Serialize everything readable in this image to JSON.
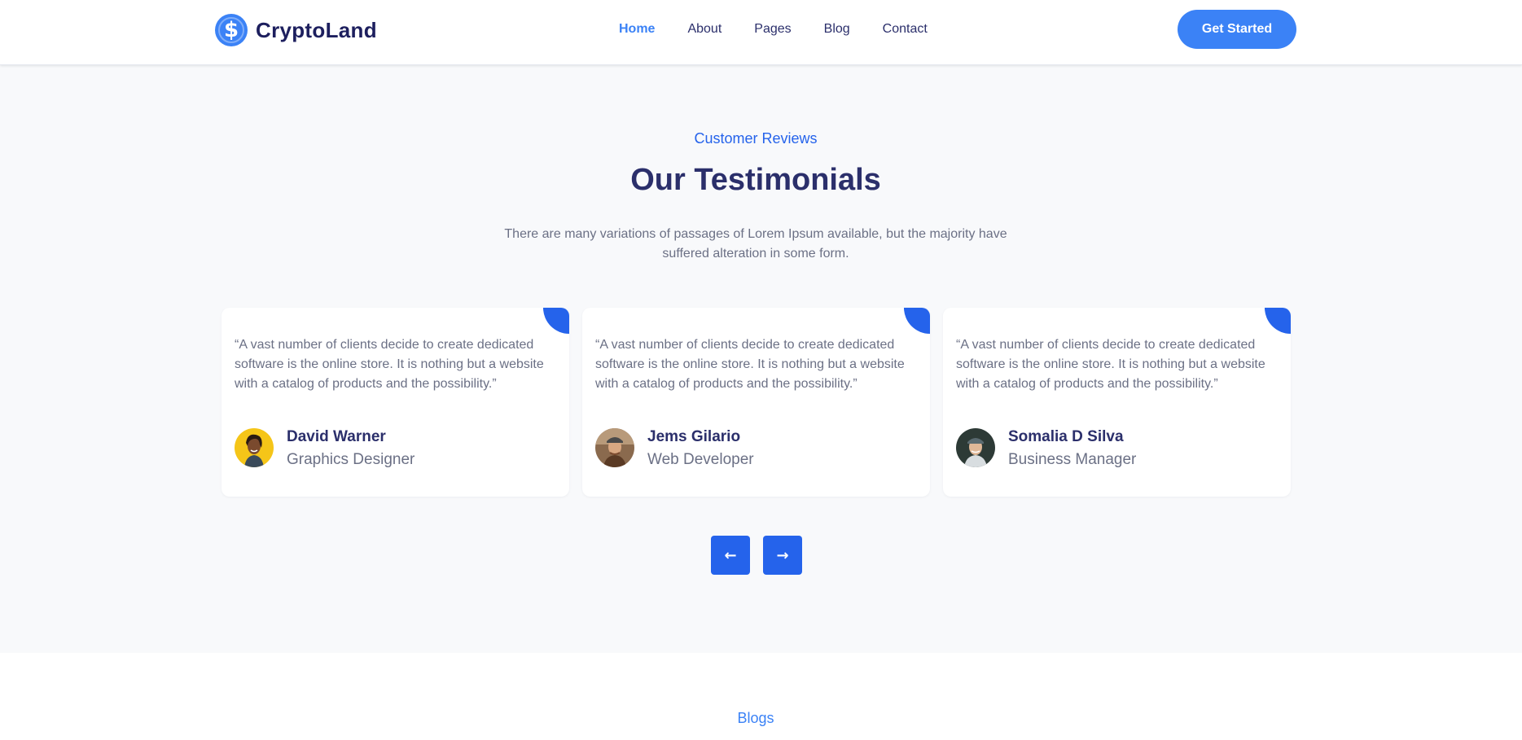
{
  "brand": {
    "name": "CryptoLand",
    "logo_symbol": "$",
    "icon": "dollar-coin-icon"
  },
  "nav": {
    "items": [
      {
        "label": "Home",
        "active": true
      },
      {
        "label": "About"
      },
      {
        "label": "Pages"
      },
      {
        "label": "Blog"
      },
      {
        "label": "Contact"
      }
    ],
    "cta_label": "Get Started"
  },
  "testimonials": {
    "eyebrow": "Customer Reviews",
    "title": "Our Testimonials",
    "description": "There are many variations of passages of Lorem Ipsum available, but the majority have suffered alteration in some form.",
    "cards": [
      {
        "quote": "“A vast number of clients decide to create dedicated software is the online store. It is nothing but a website with a catalog of products and the possibility.”",
        "name": "David Warner",
        "role": "Graphics Designer"
      },
      {
        "quote": "“A vast number of clients decide to create dedicated software is the online store. It is nothing but a website with a catalog of products and the possibility.”",
        "name": "Jems Gilario",
        "role": "Web Developer"
      },
      {
        "quote": "“A vast number of clients decide to create dedicated software is the online store. It is nothing but a website with a catalog of products and the possibility.”",
        "name": "Somalia D Silva",
        "role": "Business Manager"
      }
    ],
    "prev_icon": "←",
    "next_icon": "→"
  },
  "blogs": {
    "eyebrow": "Blogs"
  },
  "colors": {
    "accent": "#3b82f6",
    "accent_dark": "#2563eb",
    "heading": "#2b2f6b",
    "muted": "#6b7085"
  }
}
